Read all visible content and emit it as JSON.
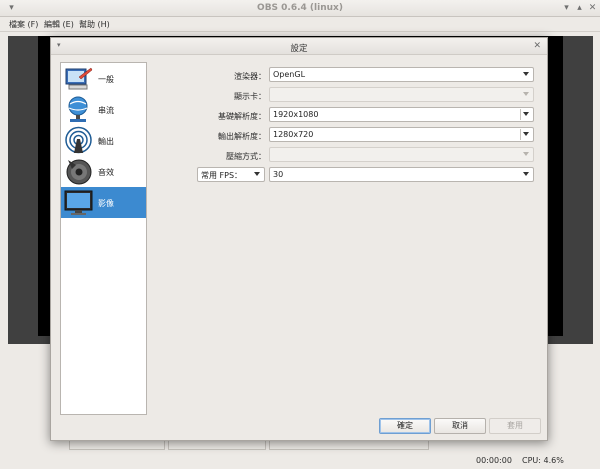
{
  "window": {
    "title": "OBS 0.6.4 (linux)",
    "menus": [
      "檔案 (F)",
      "編輯 (E)",
      "幫助 (H)"
    ],
    "status": {
      "time": "00:00:00",
      "cpu": "CPU: 4.6%"
    }
  },
  "dialog": {
    "title": "設定",
    "sidebar": [
      {
        "label": "一般",
        "icon": "general-settings-icon"
      },
      {
        "label": "串流",
        "icon": "stream-globe-icon"
      },
      {
        "label": "輸出",
        "icon": "output-broadcast-icon"
      },
      {
        "label": "音效",
        "icon": "audio-speaker-icon"
      },
      {
        "label": "影像",
        "icon": "video-monitor-icon",
        "selected": true
      }
    ],
    "form": {
      "renderer_label": "渲染器：",
      "renderer_value": "OpenGL",
      "adapter_label": "顯示卡：",
      "adapter_value": "",
      "base_res_label": "基礎解析度：",
      "base_res_value": "1920x1080",
      "output_res_label": "輸出解析度：",
      "output_res_value": "1280x720",
      "downscale_label": "壓縮方式：",
      "downscale_value": "",
      "fps_type_value": "常用 FPS：",
      "fps_value": "30"
    },
    "buttons": {
      "ok": "確定",
      "cancel": "取消",
      "apply": "套用"
    }
  },
  "colors": {
    "accent": "#3c8ad0",
    "window_bg": "#edeae6"
  }
}
